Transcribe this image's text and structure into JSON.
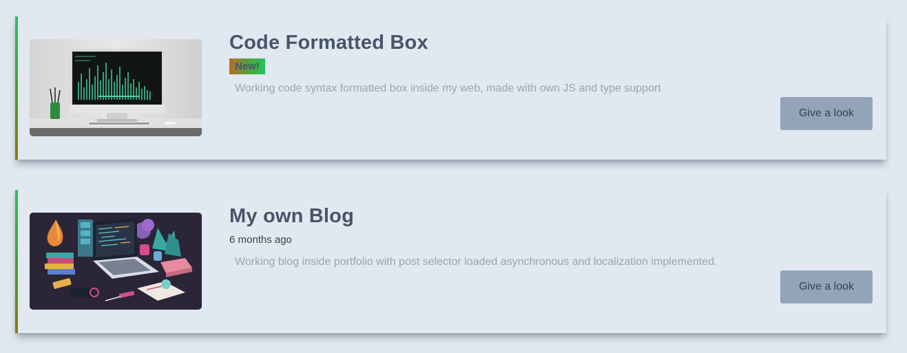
{
  "projects": [
    {
      "title": "Code Formatted Box",
      "badge": "New!",
      "description": "Working code syntax formatted box inside my web, made with own JS and type support",
      "button_label": "Give a look",
      "image_icon": "desktop-computer-code-image"
    },
    {
      "title": "My own Blog",
      "date": "6 months ago",
      "description": "Working blog inside portfolio with post selector loaded asynchronous and localization implemented.",
      "button_label": "Give a look",
      "image_icon": "laptop-isometric-illustration-image"
    }
  ],
  "colors": {
    "background": "#e2e8f0",
    "title": "#475569",
    "description": "#9ca3af",
    "button_bg": "#94a3b8",
    "accent_top": "#22c55e",
    "accent_bottom": "#8b7a14"
  }
}
